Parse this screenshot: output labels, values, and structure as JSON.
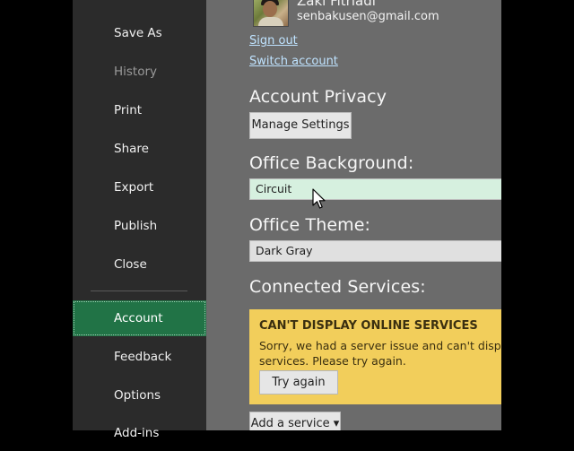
{
  "nav": {
    "items": [
      {
        "label": "Save As",
        "state": "normal"
      },
      {
        "label": "History",
        "state": "disabled"
      },
      {
        "label": "Print",
        "state": "normal"
      },
      {
        "label": "Share",
        "state": "normal"
      },
      {
        "label": "Export",
        "state": "normal"
      },
      {
        "label": "Publish",
        "state": "normal"
      },
      {
        "label": "Close",
        "state": "normal"
      },
      {
        "label": "Account",
        "state": "active"
      },
      {
        "label": "Feedback",
        "state": "normal"
      },
      {
        "label": "Options",
        "state": "normal"
      },
      {
        "label": "Add-ins",
        "state": "normal"
      }
    ]
  },
  "user": {
    "name": "Zaki Fitriadi",
    "email": "senbakusen@gmail.com",
    "sign_out": "Sign out",
    "switch_account": "Switch account"
  },
  "privacy": {
    "title": "Account Privacy",
    "manage_button": "Manage Settings"
  },
  "background": {
    "title": "Office Background:",
    "value": "Circuit"
  },
  "theme": {
    "title": "Office Theme:",
    "value": "Dark Gray"
  },
  "services": {
    "title": "Connected Services:",
    "warning_title": "CAN'T DISPLAY ONLINE SERVICES",
    "warning_line1": "Sorry, we had a server issue and can't display yo",
    "warning_line2": "services. Please try again.",
    "try_again": "Try again",
    "add_service": "Add a service ▾"
  },
  "colors": {
    "nav_bg": "#2b2b2b",
    "main_bg": "#6b6b6b",
    "active_nav": "#217346",
    "background_select": "#d6f0df",
    "theme_select": "#e0e0e0",
    "warning_bg": "#f2ce5b",
    "link": "#bfe3ff"
  }
}
